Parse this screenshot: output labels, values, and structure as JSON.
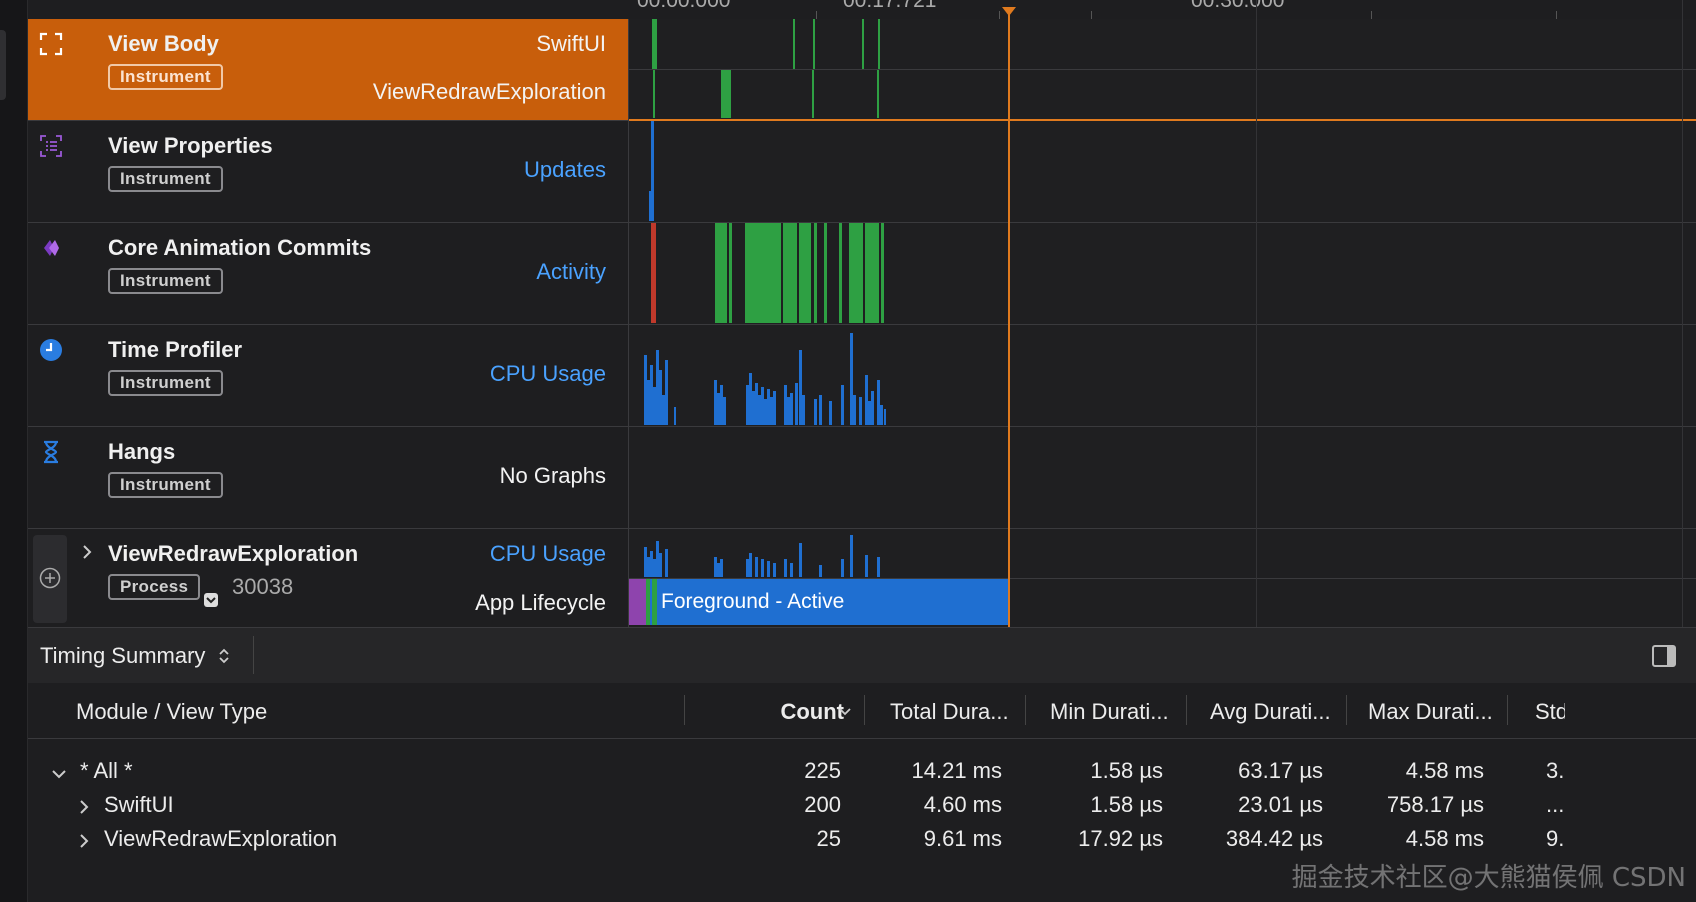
{
  "ruler": {
    "ticks": [
      "00:00.000",
      "00:17.721",
      "00:30.000"
    ]
  },
  "tracks": [
    {
      "title": "View Body",
      "badge": "Instrument",
      "label_top": "SwiftUI",
      "label_bottom": "ViewRedrawExploration",
      "icon": "focus-frame-icon"
    },
    {
      "title": "View Properties",
      "badge": "Instrument",
      "label": "Updates",
      "icon": "list-icon"
    },
    {
      "title": "Core Animation Commits",
      "badge": "Instrument",
      "label": "Activity",
      "icon": "layers-diamond-icon"
    },
    {
      "title": "Time Profiler",
      "badge": "Instrument",
      "label": "CPU Usage",
      "icon": "clock-icon"
    },
    {
      "title": "Hangs",
      "badge": "Instrument",
      "label": "No Graphs",
      "icon": "hourglass-icon"
    },
    {
      "title": "ViewRedrawExploration",
      "badge": "Process",
      "pid": "30038",
      "label_top": "CPU Usage",
      "label_bottom": "App Lifecycle",
      "lifecycle_state": "Foreground - Active",
      "icon": "add-circle-icon"
    }
  ],
  "summary": {
    "selector": "Timing Summary"
  },
  "table": {
    "columns": [
      "Module / View Type",
      "Count",
      "Total Dura...",
      "Min Durati...",
      "Avg Durati...",
      "Max Durati...",
      "Std"
    ],
    "rows": [
      {
        "name": "* All *",
        "count": "225",
        "total": "14.21 ms",
        "min": "1.58 µs",
        "avg": "63.17 µs",
        "max": "4.58 ms",
        "std": "3..."
      },
      {
        "name": "SwiftUI",
        "count": "200",
        "total": "4.60 ms",
        "min": "1.58 µs",
        "avg": "23.01 µs",
        "max": "758.17 µs",
        "std": "..."
      },
      {
        "name": "ViewRedrawExploration",
        "count": "25",
        "total": "9.61 ms",
        "min": "17.92 µs",
        "avg": "384.42 µs",
        "max": "4.58 ms",
        "std": "9..."
      }
    ]
  },
  "watermark": "掘金技术社区@大熊猫侯佩 CSDN",
  "colors": {
    "selected": "#c85e0b",
    "accent_blue": "#4aa2ff",
    "green": "#2ea043",
    "cpu_blue": "#1f6fd1",
    "playhead": "#e07a1e"
  }
}
